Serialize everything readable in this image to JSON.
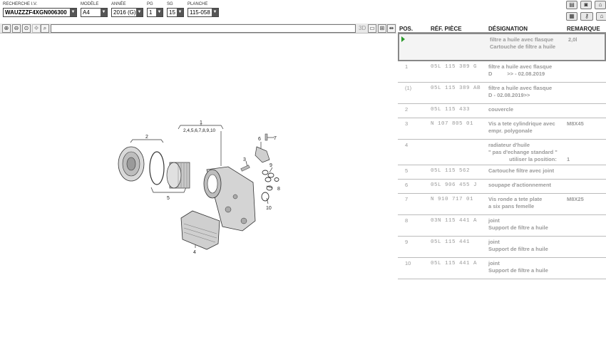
{
  "filters": [
    {
      "label": "RECHERCHE I.V.",
      "value": "WAUZZZF4XGN006300"
    },
    {
      "label": "MODÈLE",
      "value": "A4"
    },
    {
      "label": "ANNÉE",
      "value": "2016 (G)"
    },
    {
      "label": "PG",
      "value": "1"
    },
    {
      "label": "SG",
      "value": "15"
    },
    {
      "label": "PLANCHE",
      "value": "115-058"
    }
  ],
  "toolbar": {
    "label_3d": "3D",
    "search_value": ""
  },
  "table": {
    "headers": {
      "pos": "POS.",
      "ref": "RÉF. PIÈCE",
      "desig": "DÉSIGNATION",
      "rem": "REMARQUE"
    },
    "rows": [
      {
        "pos": "",
        "ref": "",
        "desig": "filtre a huile avec flasque\nCartouche de filtre a huile",
        "rem": "2,0l",
        "selected": true
      },
      {
        "pos": "1",
        "ref": "05L 115 389 G",
        "desig": "filtre a huile avec flasque\nD          >> - 02.08.2019",
        "rem": ""
      },
      {
        "pos": "(1)",
        "ref": "05L 115 389 AB",
        "desig": "filtre a huile avec flasque\nD - 02.08.2019>>",
        "rem": ""
      },
      {
        "pos": "2",
        "ref": "05L 115 433",
        "desig": "couvercle",
        "rem": ""
      },
      {
        "pos": "3",
        "ref": "N   107 805 01",
        "desig": "Vis a tete cylindrique avec\nempr. polygonale",
        "rem": "M8X45"
      },
      {
        "pos": "4",
        "ref": "",
        "desig": "radiateur d'huile\n\" pas d'echange standard \"\n              utiliser la position:",
        "rem": "\n\n1"
      },
      {
        "pos": "5",
        "ref": "05L 115 562",
        "desig": "Cartouche filtre avec joint",
        "rem": ""
      },
      {
        "pos": "6",
        "ref": "05L 906 455 J",
        "desig": "soupape d'actionnement",
        "rem": ""
      },
      {
        "pos": "7",
        "ref": "N   910 717 01",
        "desig": "Vis ronde a tete plate\na six pans femelle",
        "rem": "M8X25"
      },
      {
        "pos": "8",
        "ref": "03N 115 441 A",
        "desig": "joint\nSupport de filtre a huile",
        "rem": ""
      },
      {
        "pos": "9",
        "ref": "05L 115 441",
        "desig": "joint\nSupport de filtre a huile",
        "rem": ""
      },
      {
        "pos": "10",
        "ref": "05L 115 441 A",
        "desig": "joint\nSupport de filtre a huile",
        "rem": ""
      }
    ]
  },
  "callouts": {
    "c1": "1",
    "c1sub": "2,4,5,6,7,8,9,10",
    "c2": "2",
    "c3": "3",
    "c4": "4",
    "c5": "5",
    "c6": "6",
    "c7": "7",
    "c8": "8",
    "c9": "9",
    "c10": "10"
  },
  "icons": [
    "printer-icon",
    "catalog-icon",
    "shop-icon",
    "keyboard-icon",
    "key-icon",
    "zoom-in-icon",
    "zoom-out-icon",
    "zoom-area-icon",
    "pan-icon",
    "search-icon",
    "grid-icon",
    "fit-icon"
  ]
}
